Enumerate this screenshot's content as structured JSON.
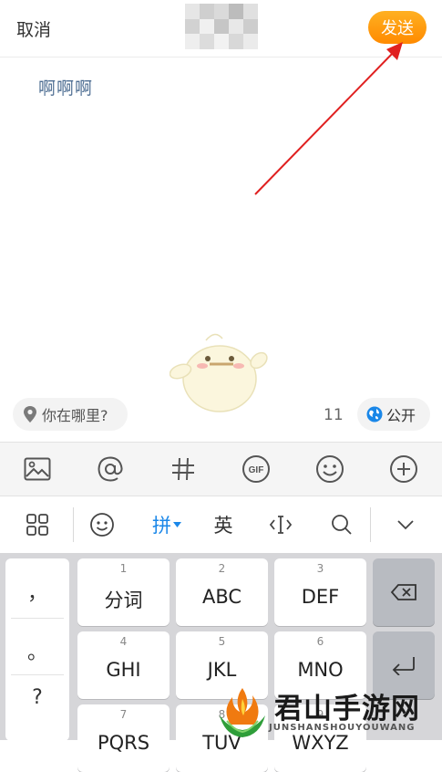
{
  "header": {
    "cancel_label": "取消",
    "send_label": "发送"
  },
  "compose": {
    "text": "啊啊啊"
  },
  "footer": {
    "location_label": "你在哪里?",
    "char_count": "11",
    "visibility_label": "公开"
  },
  "toolbar": {
    "items": [
      "image-icon",
      "mention-icon",
      "hashtag-icon",
      "gif-icon",
      "emoji-icon",
      "add-icon"
    ],
    "gif_text": "GIF"
  },
  "keyboard_bar": {
    "pinyin_label": "拼",
    "english_label": "英"
  },
  "keyboard": {
    "punctuation": [
      "，",
      "。",
      "?"
    ],
    "keys": [
      {
        "num": "1",
        "label": "分词"
      },
      {
        "num": "2",
        "label": "ABC"
      },
      {
        "num": "3",
        "label": "DEF"
      },
      {
        "num": "4",
        "label": "GHI"
      },
      {
        "num": "5",
        "label": "JKL"
      },
      {
        "num": "6",
        "label": "MNO"
      },
      {
        "num": "7",
        "label": "PQRS"
      },
      {
        "num": "8",
        "label": "TUV"
      },
      {
        "num": "9",
        "label": "WXYZ"
      }
    ]
  },
  "watermark": {
    "text": "君山手游网",
    "subtext": "JUNSHANSHOUYOUWANG"
  },
  "colors": {
    "accent": "#ff9a0e",
    "link_blue": "#1a87e8",
    "post_text": "#4d6d92",
    "arrow_red": "#e02020"
  }
}
